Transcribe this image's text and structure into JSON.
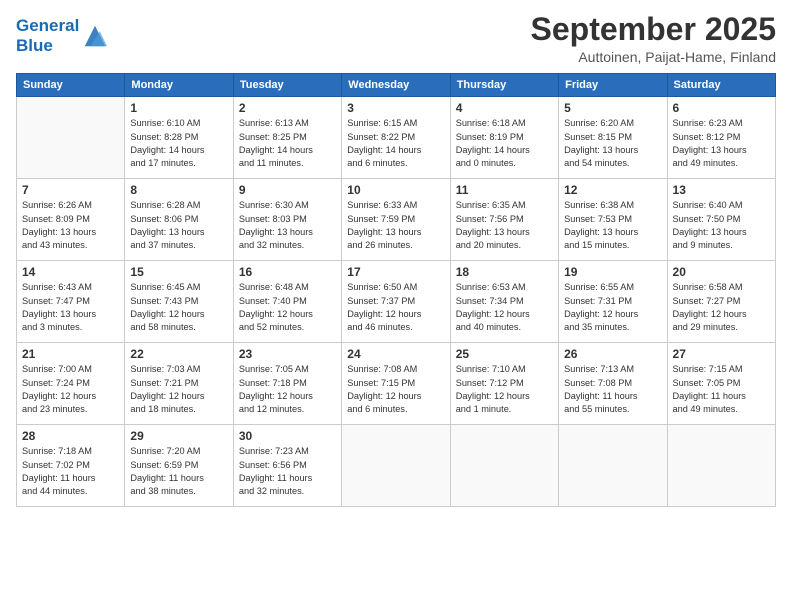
{
  "header": {
    "logo_line1": "General",
    "logo_line2": "Blue",
    "month": "September 2025",
    "location": "Auttoinen, Paijat-Hame, Finland"
  },
  "days_of_week": [
    "Sunday",
    "Monday",
    "Tuesday",
    "Wednesday",
    "Thursday",
    "Friday",
    "Saturday"
  ],
  "weeks": [
    [
      {
        "day": "",
        "info": ""
      },
      {
        "day": "1",
        "info": "Sunrise: 6:10 AM\nSunset: 8:28 PM\nDaylight: 14 hours\nand 17 minutes."
      },
      {
        "day": "2",
        "info": "Sunrise: 6:13 AM\nSunset: 8:25 PM\nDaylight: 14 hours\nand 11 minutes."
      },
      {
        "day": "3",
        "info": "Sunrise: 6:15 AM\nSunset: 8:22 PM\nDaylight: 14 hours\nand 6 minutes."
      },
      {
        "day": "4",
        "info": "Sunrise: 6:18 AM\nSunset: 8:19 PM\nDaylight: 14 hours\nand 0 minutes."
      },
      {
        "day": "5",
        "info": "Sunrise: 6:20 AM\nSunset: 8:15 PM\nDaylight: 13 hours\nand 54 minutes."
      },
      {
        "day": "6",
        "info": "Sunrise: 6:23 AM\nSunset: 8:12 PM\nDaylight: 13 hours\nand 49 minutes."
      }
    ],
    [
      {
        "day": "7",
        "info": "Sunrise: 6:26 AM\nSunset: 8:09 PM\nDaylight: 13 hours\nand 43 minutes."
      },
      {
        "day": "8",
        "info": "Sunrise: 6:28 AM\nSunset: 8:06 PM\nDaylight: 13 hours\nand 37 minutes."
      },
      {
        "day": "9",
        "info": "Sunrise: 6:30 AM\nSunset: 8:03 PM\nDaylight: 13 hours\nand 32 minutes."
      },
      {
        "day": "10",
        "info": "Sunrise: 6:33 AM\nSunset: 7:59 PM\nDaylight: 13 hours\nand 26 minutes."
      },
      {
        "day": "11",
        "info": "Sunrise: 6:35 AM\nSunset: 7:56 PM\nDaylight: 13 hours\nand 20 minutes."
      },
      {
        "day": "12",
        "info": "Sunrise: 6:38 AM\nSunset: 7:53 PM\nDaylight: 13 hours\nand 15 minutes."
      },
      {
        "day": "13",
        "info": "Sunrise: 6:40 AM\nSunset: 7:50 PM\nDaylight: 13 hours\nand 9 minutes."
      }
    ],
    [
      {
        "day": "14",
        "info": "Sunrise: 6:43 AM\nSunset: 7:47 PM\nDaylight: 13 hours\nand 3 minutes."
      },
      {
        "day": "15",
        "info": "Sunrise: 6:45 AM\nSunset: 7:43 PM\nDaylight: 12 hours\nand 58 minutes."
      },
      {
        "day": "16",
        "info": "Sunrise: 6:48 AM\nSunset: 7:40 PM\nDaylight: 12 hours\nand 52 minutes."
      },
      {
        "day": "17",
        "info": "Sunrise: 6:50 AM\nSunset: 7:37 PM\nDaylight: 12 hours\nand 46 minutes."
      },
      {
        "day": "18",
        "info": "Sunrise: 6:53 AM\nSunset: 7:34 PM\nDaylight: 12 hours\nand 40 minutes."
      },
      {
        "day": "19",
        "info": "Sunrise: 6:55 AM\nSunset: 7:31 PM\nDaylight: 12 hours\nand 35 minutes."
      },
      {
        "day": "20",
        "info": "Sunrise: 6:58 AM\nSunset: 7:27 PM\nDaylight: 12 hours\nand 29 minutes."
      }
    ],
    [
      {
        "day": "21",
        "info": "Sunrise: 7:00 AM\nSunset: 7:24 PM\nDaylight: 12 hours\nand 23 minutes."
      },
      {
        "day": "22",
        "info": "Sunrise: 7:03 AM\nSunset: 7:21 PM\nDaylight: 12 hours\nand 18 minutes."
      },
      {
        "day": "23",
        "info": "Sunrise: 7:05 AM\nSunset: 7:18 PM\nDaylight: 12 hours\nand 12 minutes."
      },
      {
        "day": "24",
        "info": "Sunrise: 7:08 AM\nSunset: 7:15 PM\nDaylight: 12 hours\nand 6 minutes."
      },
      {
        "day": "25",
        "info": "Sunrise: 7:10 AM\nSunset: 7:12 PM\nDaylight: 12 hours\nand 1 minute."
      },
      {
        "day": "26",
        "info": "Sunrise: 7:13 AM\nSunset: 7:08 PM\nDaylight: 11 hours\nand 55 minutes."
      },
      {
        "day": "27",
        "info": "Sunrise: 7:15 AM\nSunset: 7:05 PM\nDaylight: 11 hours\nand 49 minutes."
      }
    ],
    [
      {
        "day": "28",
        "info": "Sunrise: 7:18 AM\nSunset: 7:02 PM\nDaylight: 11 hours\nand 44 minutes."
      },
      {
        "day": "29",
        "info": "Sunrise: 7:20 AM\nSunset: 6:59 PM\nDaylight: 11 hours\nand 38 minutes."
      },
      {
        "day": "30",
        "info": "Sunrise: 7:23 AM\nSunset: 6:56 PM\nDaylight: 11 hours\nand 32 minutes."
      },
      {
        "day": "",
        "info": ""
      },
      {
        "day": "",
        "info": ""
      },
      {
        "day": "",
        "info": ""
      },
      {
        "day": "",
        "info": ""
      }
    ]
  ]
}
